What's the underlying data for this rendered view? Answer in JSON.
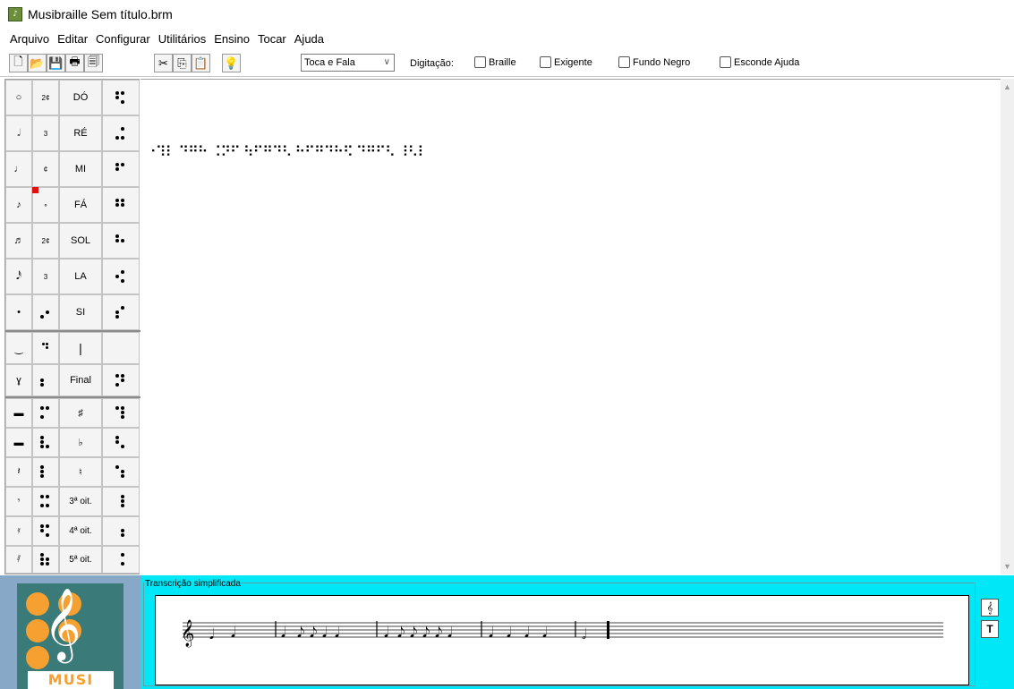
{
  "window": {
    "title": "Musibraille Sem título.brm"
  },
  "menu": [
    "Arquivo",
    "Editar",
    "Configurar",
    "Utilitários",
    "Ensino",
    "Tocar",
    "Ajuda"
  ],
  "toolbar": {
    "mode_select": "Toca e Fala",
    "digitacao_label": "Digitação:",
    "checkboxes": [
      {
        "label": "Braille",
        "checked": false
      },
      {
        "label": "Exigente",
        "checked": false
      },
      {
        "label": "Fundo Negro",
        "checked": false
      },
      {
        "label": "Esconde Ajuda",
        "checked": false
      }
    ]
  },
  "palette": {
    "notes": [
      "DÓ",
      "RÉ",
      "MI",
      "FÁ",
      "SOL",
      "LA",
      "SI"
    ],
    "final_label": "Final",
    "octaves": [
      "3ª oit.",
      "4ª oit.",
      "5ª oit."
    ],
    "durations": [
      "2¢",
      "3",
      "¢",
      "∘",
      "2¢",
      "3"
    ]
  },
  "editor": {
    "braille_text": "⠐⠹⠇ ⠙⠛⠓ ⠨⠝⠋ ⠳⠋⠛⠙⠣ ⠓⠋⠛⠙⠓⠫ ⠙⠛⠋⠣ ⠸⠣⠇"
  },
  "transcription": {
    "title": "Transcrição simplificada",
    "btn_clef": "𝄞",
    "btn_text": "T"
  },
  "logo": {
    "text": "MUSI BRAILLE"
  }
}
